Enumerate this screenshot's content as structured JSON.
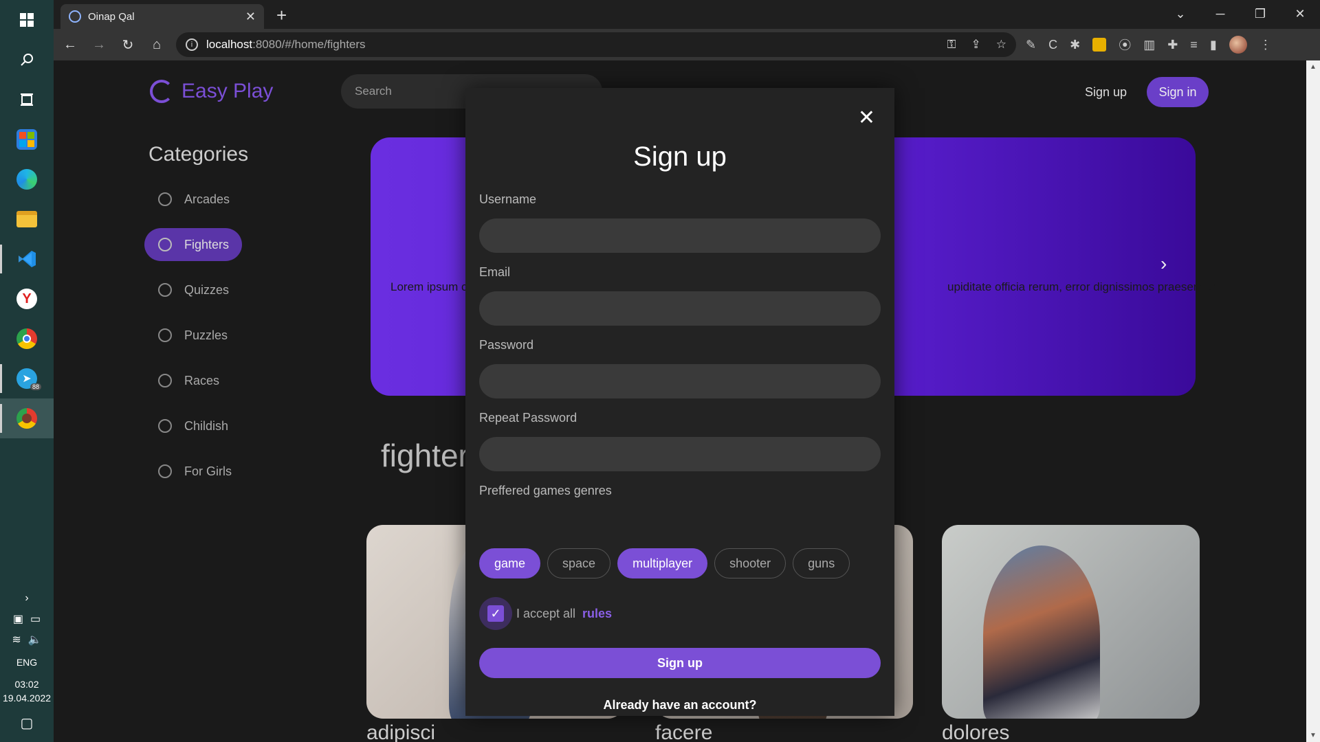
{
  "colors": {
    "accent": "#7b4fd6",
    "bg": "#1a1a1a",
    "modal_bg": "#232323",
    "taskbar": "#1e3a3a"
  },
  "taskbar": {
    "icons": [
      "windows-icon",
      "search-icon",
      "task-view-icon",
      "store-icon",
      "edge-icon",
      "explorer-icon",
      "vscode-icon",
      "yandex-icon",
      "chrome-icon",
      "telegram-icon",
      "chrome-profile-icon"
    ],
    "telegram_badge": "88",
    "language": "ENG",
    "time": "03:02",
    "date": "19.04.2022"
  },
  "browser": {
    "tab_title": "Oinap Qal",
    "url_host": "localhost",
    "url_path": ":8080/#/home/fighters"
  },
  "site": {
    "brand": "Easy Play",
    "search_placeholder": "Search",
    "signup_link": "Sign up",
    "signin_button": "Sign in",
    "categories_title": "Categories",
    "categories": [
      {
        "label": "Arcades",
        "icon": "arcade-icon"
      },
      {
        "label": "Fighters",
        "icon": "fire-icon",
        "active": true
      },
      {
        "label": "Quizzes",
        "icon": "graduation-cap-icon"
      },
      {
        "label": "Puzzles",
        "icon": "puzzle-icon"
      },
      {
        "label": "Races",
        "icon": "car-icon"
      },
      {
        "label": "Childish",
        "icon": "rattle-icon"
      },
      {
        "label": "For Girls",
        "icon": "girl-icon"
      }
    ],
    "hero_text_left": "Lorem ipsum c",
    "hero_text_right": "upiditate officia rerum, error dignissimos praesentium.",
    "section_title": "fighter",
    "cards": [
      {
        "title": "adipisci"
      },
      {
        "title": "facere"
      },
      {
        "title": "dolores"
      }
    ]
  },
  "modal": {
    "title": "Sign up",
    "username_label": "Username",
    "username_value": "",
    "email_label": "Email",
    "email_value": "",
    "password_label": "Password",
    "password_value": "",
    "repeat_label": "Repeat Password",
    "repeat_value": "",
    "genres_label": "Preffered games genres",
    "genres": [
      {
        "label": "game",
        "selected": true
      },
      {
        "label": "space",
        "selected": false
      },
      {
        "label": "multiplayer",
        "selected": true
      },
      {
        "label": "shooter",
        "selected": false
      },
      {
        "label": "guns",
        "selected": false
      }
    ],
    "accept_text": "I accept all",
    "rules_link": "rules",
    "accept_checked": true,
    "submit_label": "Sign up",
    "already_label": "Already have an account?"
  }
}
